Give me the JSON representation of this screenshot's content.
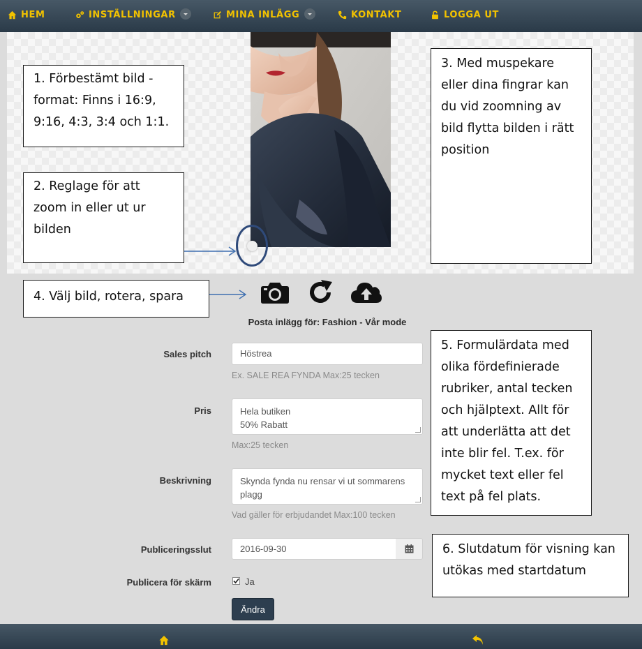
{
  "nav": {
    "home": "HEM",
    "settings": "INSTÄLLNINGAR",
    "my_posts": "MINA INLÄGG",
    "contact": "KONTAKT",
    "logout": "LOGGA UT"
  },
  "callouts": {
    "c1": "1. Förbestämt bild - format: Finns i 16:9, 9:16, 4:3, 3:4 och 1:1.",
    "c2": "2. Reglage för att zoom in eller ut ur bilden",
    "c3": "3. Med muspekare eller dina fingrar kan du vid zoomning av bild flytta bilden i rätt position",
    "c4": "4. Välj bild, rotera, spara",
    "c5": "5. Formulärdata med olika fördefinierade rubriker, antal tecken och hjälptext. Allt för att underlätta att det inte blir fel. T.ex. för mycket text eller fel text på fel plats.",
    "c6": "6. Slutdatum för visning kan utökas med startdatum"
  },
  "toolbar": {
    "icons": [
      "camera-icon",
      "rotate-icon",
      "cloud-upload-icon"
    ]
  },
  "form": {
    "heading": "Posta inlägg för: Fashion - Vår mode",
    "sales_pitch": {
      "label": "Sales pitch",
      "value": "Höstrea",
      "help": "Ex. SALE REA FYNDA Max:25 tecken"
    },
    "price": {
      "label": "Pris",
      "line1": "Hela butiken",
      "line2": "50% Rabatt",
      "help": "Max:25 tecken"
    },
    "description": {
      "label": "Beskrivning",
      "line1": "Skynda fynda nu rensar vi ut sommarens",
      "line2": "plagg",
      "help": "Vad gäller för erbjudandet Max:100 tecken"
    },
    "publish_end": {
      "label": "Publiceringsslut",
      "value": "2016-09-30"
    },
    "publish_screen": {
      "label": "Publicera för skärm",
      "option": "Ja",
      "checked": true
    },
    "submit": "Ändra"
  },
  "colors": {
    "nav_text": "#f2c200",
    "nav_bg": "#2f3f4d",
    "accent_circle": "#2f4a7a",
    "button_bg": "#2d3e4f"
  }
}
